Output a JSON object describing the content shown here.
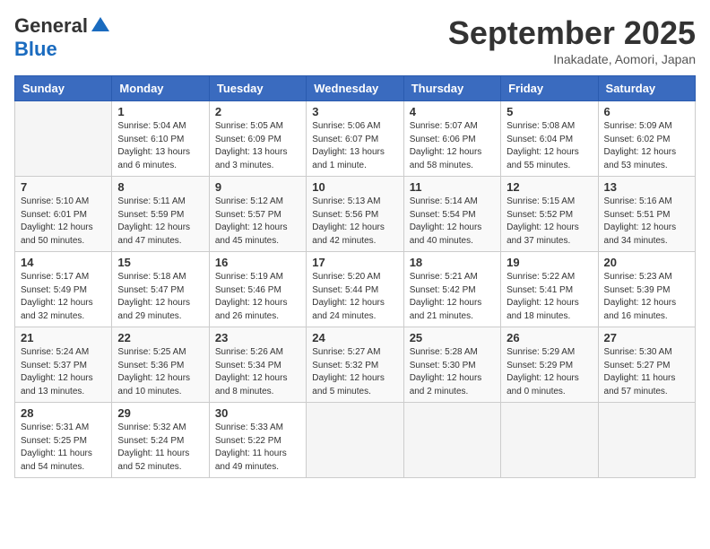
{
  "logo": {
    "general": "General",
    "blue": "Blue"
  },
  "title": {
    "month": "September 2025",
    "location": "Inakadate, Aomori, Japan"
  },
  "headers": [
    "Sunday",
    "Monday",
    "Tuesday",
    "Wednesday",
    "Thursday",
    "Friday",
    "Saturday"
  ],
  "weeks": [
    [
      {
        "day": "",
        "info": ""
      },
      {
        "day": "1",
        "info": "Sunrise: 5:04 AM\nSunset: 6:10 PM\nDaylight: 13 hours\nand 6 minutes."
      },
      {
        "day": "2",
        "info": "Sunrise: 5:05 AM\nSunset: 6:09 PM\nDaylight: 13 hours\nand 3 minutes."
      },
      {
        "day": "3",
        "info": "Sunrise: 5:06 AM\nSunset: 6:07 PM\nDaylight: 13 hours\nand 1 minute."
      },
      {
        "day": "4",
        "info": "Sunrise: 5:07 AM\nSunset: 6:06 PM\nDaylight: 12 hours\nand 58 minutes."
      },
      {
        "day": "5",
        "info": "Sunrise: 5:08 AM\nSunset: 6:04 PM\nDaylight: 12 hours\nand 55 minutes."
      },
      {
        "day": "6",
        "info": "Sunrise: 5:09 AM\nSunset: 6:02 PM\nDaylight: 12 hours\nand 53 minutes."
      }
    ],
    [
      {
        "day": "7",
        "info": "Sunrise: 5:10 AM\nSunset: 6:01 PM\nDaylight: 12 hours\nand 50 minutes."
      },
      {
        "day": "8",
        "info": "Sunrise: 5:11 AM\nSunset: 5:59 PM\nDaylight: 12 hours\nand 47 minutes."
      },
      {
        "day": "9",
        "info": "Sunrise: 5:12 AM\nSunset: 5:57 PM\nDaylight: 12 hours\nand 45 minutes."
      },
      {
        "day": "10",
        "info": "Sunrise: 5:13 AM\nSunset: 5:56 PM\nDaylight: 12 hours\nand 42 minutes."
      },
      {
        "day": "11",
        "info": "Sunrise: 5:14 AM\nSunset: 5:54 PM\nDaylight: 12 hours\nand 40 minutes."
      },
      {
        "day": "12",
        "info": "Sunrise: 5:15 AM\nSunset: 5:52 PM\nDaylight: 12 hours\nand 37 minutes."
      },
      {
        "day": "13",
        "info": "Sunrise: 5:16 AM\nSunset: 5:51 PM\nDaylight: 12 hours\nand 34 minutes."
      }
    ],
    [
      {
        "day": "14",
        "info": "Sunrise: 5:17 AM\nSunset: 5:49 PM\nDaylight: 12 hours\nand 32 minutes."
      },
      {
        "day": "15",
        "info": "Sunrise: 5:18 AM\nSunset: 5:47 PM\nDaylight: 12 hours\nand 29 minutes."
      },
      {
        "day": "16",
        "info": "Sunrise: 5:19 AM\nSunset: 5:46 PM\nDaylight: 12 hours\nand 26 minutes."
      },
      {
        "day": "17",
        "info": "Sunrise: 5:20 AM\nSunset: 5:44 PM\nDaylight: 12 hours\nand 24 minutes."
      },
      {
        "day": "18",
        "info": "Sunrise: 5:21 AM\nSunset: 5:42 PM\nDaylight: 12 hours\nand 21 minutes."
      },
      {
        "day": "19",
        "info": "Sunrise: 5:22 AM\nSunset: 5:41 PM\nDaylight: 12 hours\nand 18 minutes."
      },
      {
        "day": "20",
        "info": "Sunrise: 5:23 AM\nSunset: 5:39 PM\nDaylight: 12 hours\nand 16 minutes."
      }
    ],
    [
      {
        "day": "21",
        "info": "Sunrise: 5:24 AM\nSunset: 5:37 PM\nDaylight: 12 hours\nand 13 minutes."
      },
      {
        "day": "22",
        "info": "Sunrise: 5:25 AM\nSunset: 5:36 PM\nDaylight: 12 hours\nand 10 minutes."
      },
      {
        "day": "23",
        "info": "Sunrise: 5:26 AM\nSunset: 5:34 PM\nDaylight: 12 hours\nand 8 minutes."
      },
      {
        "day": "24",
        "info": "Sunrise: 5:27 AM\nSunset: 5:32 PM\nDaylight: 12 hours\nand 5 minutes."
      },
      {
        "day": "25",
        "info": "Sunrise: 5:28 AM\nSunset: 5:30 PM\nDaylight: 12 hours\nand 2 minutes."
      },
      {
        "day": "26",
        "info": "Sunrise: 5:29 AM\nSunset: 5:29 PM\nDaylight: 12 hours\nand 0 minutes."
      },
      {
        "day": "27",
        "info": "Sunrise: 5:30 AM\nSunset: 5:27 PM\nDaylight: 11 hours\nand 57 minutes."
      }
    ],
    [
      {
        "day": "28",
        "info": "Sunrise: 5:31 AM\nSunset: 5:25 PM\nDaylight: 11 hours\nand 54 minutes."
      },
      {
        "day": "29",
        "info": "Sunrise: 5:32 AM\nSunset: 5:24 PM\nDaylight: 11 hours\nand 52 minutes."
      },
      {
        "day": "30",
        "info": "Sunrise: 5:33 AM\nSunset: 5:22 PM\nDaylight: 11 hours\nand 49 minutes."
      },
      {
        "day": "",
        "info": ""
      },
      {
        "day": "",
        "info": ""
      },
      {
        "day": "",
        "info": ""
      },
      {
        "day": "",
        "info": ""
      }
    ]
  ]
}
